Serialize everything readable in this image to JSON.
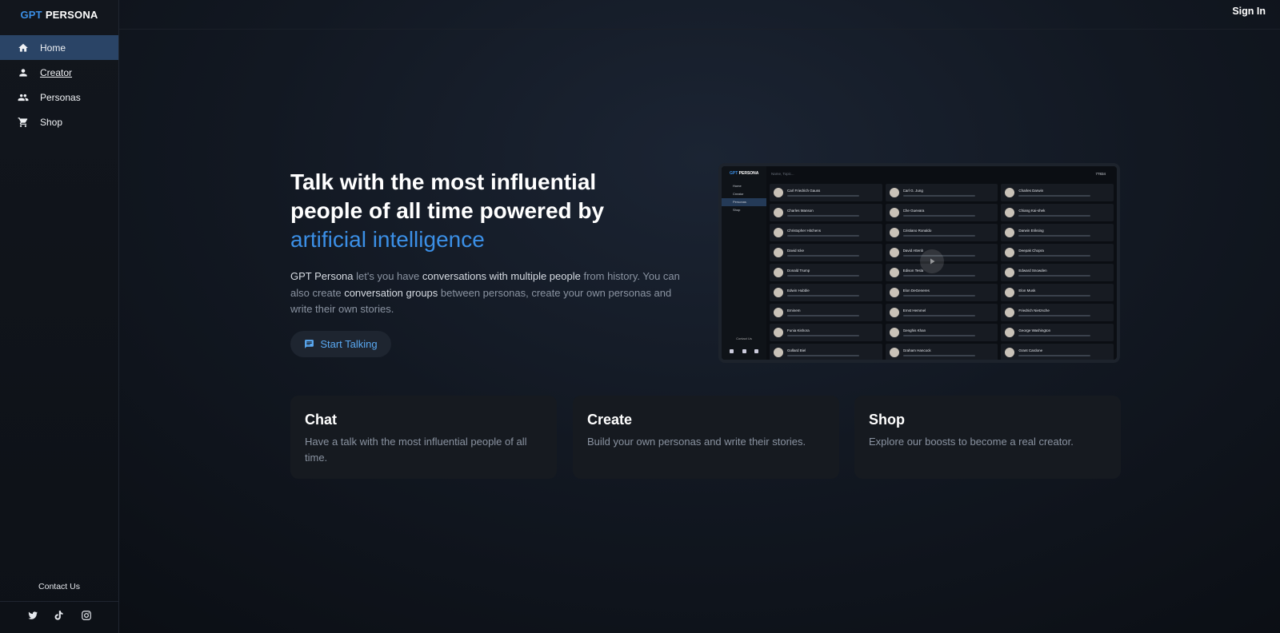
{
  "app": {
    "logo_accent": "GPT",
    "logo_rest": "PERSONA",
    "accent_color": "#3b8fe6"
  },
  "sidebar": {
    "items": [
      {
        "label": "Home",
        "icon": "home-icon",
        "active": true
      },
      {
        "label": "Creator",
        "icon": "person-icon",
        "active": false
      },
      {
        "label": "Personas",
        "icon": "group-icon",
        "active": false
      },
      {
        "label": "Shop",
        "icon": "cart-icon",
        "active": false
      }
    ],
    "contact": "Contact Us",
    "socials": [
      "twitter-icon",
      "tiktok-icon",
      "instagram-icon"
    ]
  },
  "topbar": {
    "signin": "Sign In"
  },
  "hero": {
    "title_line1": "Talk with the most influential",
    "title_line2": "people of all time powered by",
    "title_highlight": "artificial intelligence",
    "desc": {
      "p1": "GPT Persona",
      "p2": " let's you have ",
      "p3": "conversations with multiple people",
      "p4": " from history. You can also create ",
      "p5": "conversation groups",
      "p6": " between personas, create your own personas and write their own stories."
    },
    "button": "Start Talking"
  },
  "preview": {
    "logo_accent": "GPT",
    "logo_rest": "PERSONA",
    "nav": [
      "Home",
      "Creator",
      "Personas",
      "Shop"
    ],
    "search_placeholder": "Name, Topic...",
    "credits": "77834",
    "contact": "Contact Us",
    "personas": [
      "Carl Friedrich Gauss",
      "Carl G. Jung",
      "Charles Darwin",
      "Charles Manson",
      "Che Guevara",
      "Chiang Kai-shek",
      "Christopher Hitchens",
      "Cristiano Ronaldo",
      "Darwin Eriksing",
      "David Icke",
      "David Attenb",
      "Deepak Chopra",
      "Donald Trump",
      "Edison Tesla",
      "Edward Snowden",
      "Edwin Hubble",
      "Elon DeGeneres",
      "Elon Musk",
      "Eminem",
      "Ernst Hemmel",
      "Friedrich Nietzsche",
      "Funia Kishora",
      "Genghis Khan",
      "George Washington",
      "Gollard Biel",
      "Graham Hancock",
      "Grant Cardone"
    ]
  },
  "cards": [
    {
      "title": "Chat",
      "text": "Have a talk with the most influential people of all time."
    },
    {
      "title": "Create",
      "text": "Build your own personas and write their stories."
    },
    {
      "title": "Shop",
      "text": "Explore our boosts to become a real creator."
    }
  ]
}
